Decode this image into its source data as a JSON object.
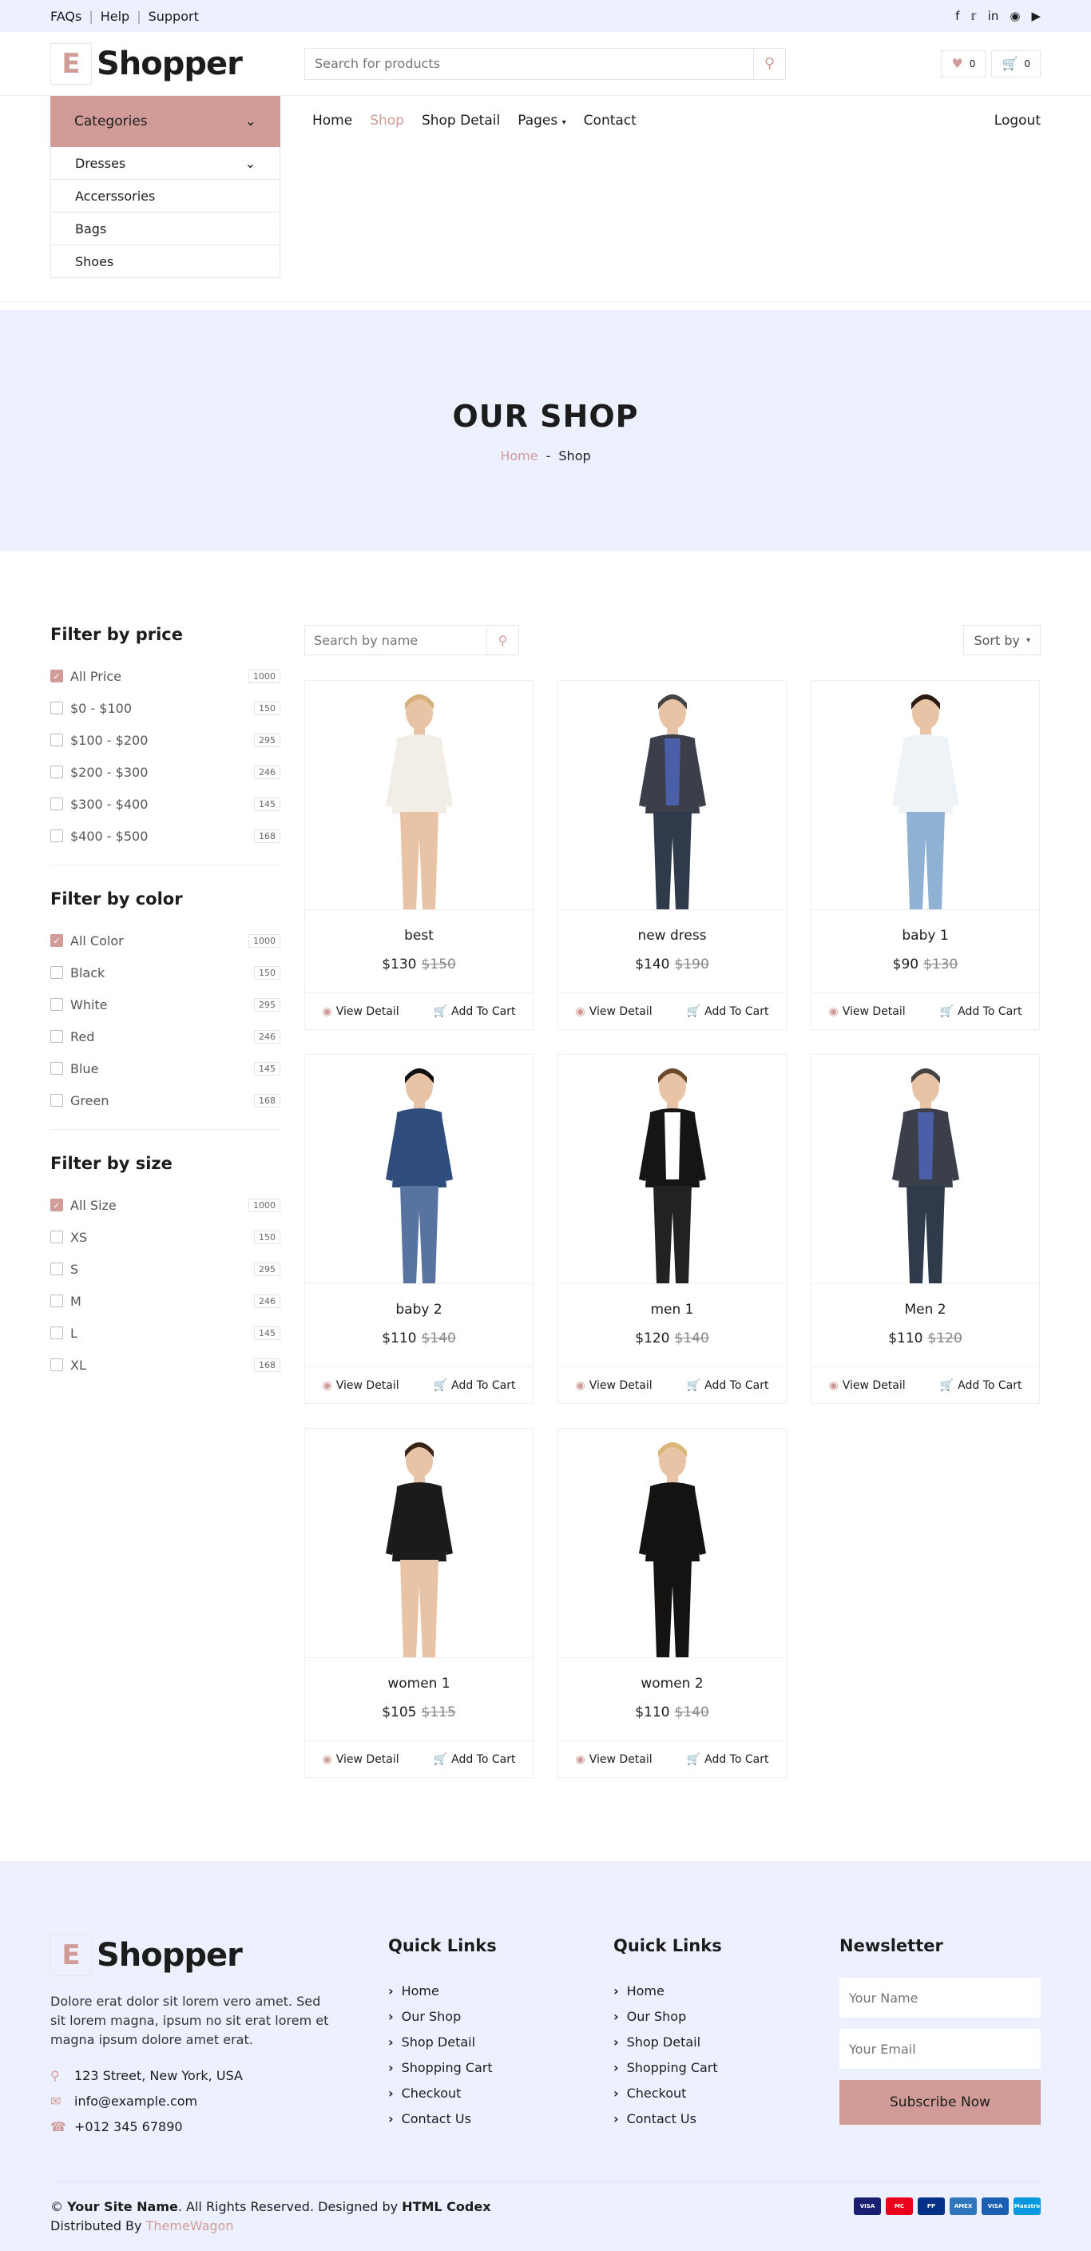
{
  "topbar": {
    "links": [
      "FAQs",
      "Help",
      "Support"
    ]
  },
  "header": {
    "logo_letter": "E",
    "logo_name": "Shopper",
    "search_placeholder": "Search for products",
    "wishlist_count": "0",
    "cart_count": "0"
  },
  "categories": {
    "title": "Categories",
    "items": [
      "Dresses",
      "Accerssories",
      "Bags",
      "Shoes"
    ]
  },
  "nav": {
    "items": [
      "Home",
      "Shop",
      "Shop Detail",
      "Pages",
      "Contact"
    ],
    "logout": "Logout"
  },
  "hero": {
    "title": "OUR SHOP",
    "crumb_home": "Home",
    "crumb_sep": "-",
    "crumb_current": "Shop"
  },
  "filters": {
    "price": {
      "title": "Filter by price",
      "rows": [
        [
          "All Price",
          "1000"
        ],
        [
          "$0 - $100",
          "150"
        ],
        [
          "$100 - $200",
          "295"
        ],
        [
          "$200 - $300",
          "246"
        ],
        [
          "$300 - $400",
          "145"
        ],
        [
          "$400 - $500",
          "168"
        ]
      ]
    },
    "color": {
      "title": "Filter by color",
      "rows": [
        [
          "All Color",
          "1000"
        ],
        [
          "Black",
          "150"
        ],
        [
          "White",
          "295"
        ],
        [
          "Red",
          "246"
        ],
        [
          "Blue",
          "145"
        ],
        [
          "Green",
          "168"
        ]
      ]
    },
    "size": {
      "title": "Filter by size",
      "rows": [
        [
          "All Size",
          "1000"
        ],
        [
          "XS",
          "150"
        ],
        [
          "S",
          "295"
        ],
        [
          "M",
          "246"
        ],
        [
          "L",
          "145"
        ],
        [
          "XL",
          "168"
        ]
      ]
    }
  },
  "toolbar": {
    "search_placeholder": "Search by name",
    "sort": "Sort by"
  },
  "products": [
    {
      "name": "best",
      "price": "$130",
      "old": "$150"
    },
    {
      "name": "new dress",
      "price": "$140",
      "old": "$190"
    },
    {
      "name": "baby 1",
      "price": "$90",
      "old": "$130"
    },
    {
      "name": "baby 2",
      "price": "$110",
      "old": "$140"
    },
    {
      "name": "men 1",
      "price": "$120",
      "old": "$140"
    },
    {
      "name": "Men 2",
      "price": "$110",
      "old": "$120"
    },
    {
      "name": "women 1",
      "price": "$105",
      "old": "$115"
    },
    {
      "name": "women 2",
      "price": "$110",
      "old": "$140"
    }
  ],
  "card": {
    "view": "View Detail",
    "add": "Add To Cart"
  },
  "footer": {
    "logo_letter": "E",
    "logo_name": "Shopper",
    "desc": "Dolore erat dolor sit lorem vero amet. Sed sit lorem magna, ipsum no sit erat lorem et magna ipsum dolore amet erat.",
    "address": "123 Street, New York, USA",
    "email": "info@example.com",
    "phone": "+012 345 67890",
    "quick1": {
      "title": "Quick Links",
      "items": [
        "Home",
        "Our Shop",
        "Shop Detail",
        "Shopping Cart",
        "Checkout",
        "Contact Us"
      ]
    },
    "quick2": {
      "title": "Quick Links",
      "items": [
        "Home",
        "Our Shop",
        "Shop Detail",
        "Shopping Cart",
        "Checkout",
        "Contact Us"
      ]
    },
    "newsletter": {
      "title": "Newsletter",
      "name_ph": "Your Name",
      "email_ph": "Your Email",
      "button": "Subscribe Now"
    },
    "copy_sym": "©",
    "site": "Your Site Name",
    "rights": ". All Rights Reserved. Designed by ",
    "codex": "HTML Codex",
    "distributed": "Distributed By ",
    "themewagon": "ThemeWagon",
    "payments": [
      "VISA",
      "MC",
      "PP",
      "AMEX",
      "VISA",
      "Maestro"
    ]
  },
  "colors": {
    "accent": "#d19c97",
    "light_bg": "#edf1ff"
  }
}
